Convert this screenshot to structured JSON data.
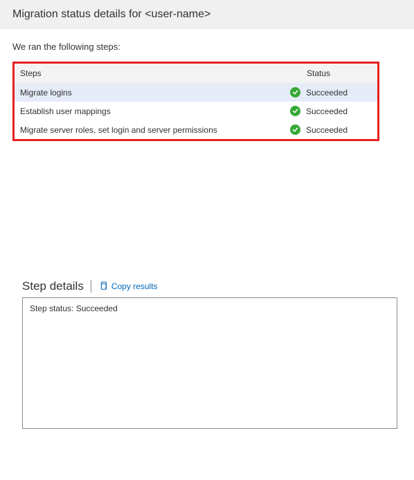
{
  "header": {
    "title": "Migration status details for <user-name>"
  },
  "intro": "We ran the following steps:",
  "table": {
    "columns": {
      "steps": "Steps",
      "status": "Status"
    },
    "rows": [
      {
        "step": "Migrate logins",
        "status": "Succeeded",
        "selected": true
      },
      {
        "step": "Establish user mappings",
        "status": "Succeeded",
        "selected": false
      },
      {
        "step": "Migrate server roles, set login and server permissions",
        "status": "Succeeded",
        "selected": false
      }
    ]
  },
  "details": {
    "title": "Step details",
    "copy_label": "Copy results",
    "status_text": "Step status: Succeeded"
  },
  "colors": {
    "success": "#37a837",
    "link": "#0066b8",
    "highlight_border": "#e62020"
  }
}
